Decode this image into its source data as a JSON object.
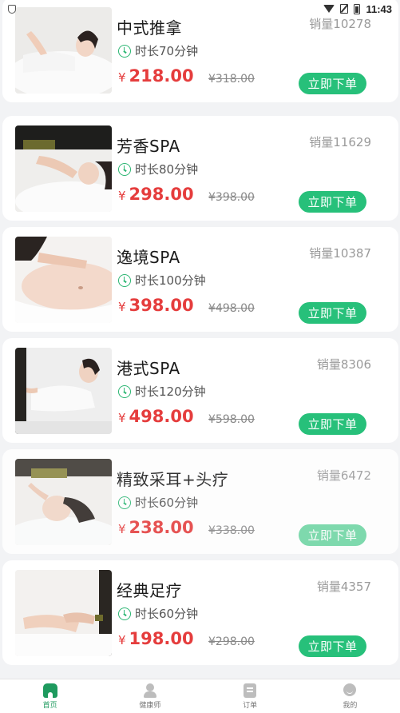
{
  "status_bar": {
    "time": "11:43"
  },
  "services": [
    {
      "name": "中式推拿",
      "sales": "销量10278",
      "duration": "时长70分钟",
      "currency": "¥",
      "price": "218.00",
      "original_price": "¥318.00",
      "order_label": "立即下单",
      "image": "massage-back-photo"
    },
    {
      "name": "芳香SPA",
      "sales": "销量11629",
      "duration": "时长80分钟",
      "currency": "¥",
      "price": "298.00",
      "original_price": "¥398.00",
      "order_label": "立即下单",
      "image": "neck-massage-photo"
    },
    {
      "name": "逸境SPA",
      "sales": "销量10387",
      "duration": "时长100分钟",
      "currency": "¥",
      "price": "398.00",
      "original_price": "¥498.00",
      "order_label": "立即下单",
      "image": "abdomen-massage-photo"
    },
    {
      "name": "港式SPA",
      "sales": "销量8306",
      "duration": "时长120分钟",
      "currency": "¥",
      "price": "498.00",
      "original_price": "¥598.00",
      "order_label": "立即下单",
      "image": "back-stretch-photo"
    },
    {
      "name": "精致采耳+头疗",
      "sales": "销量6472",
      "duration": "时长60分钟",
      "currency": "¥",
      "price": "238.00",
      "original_price": "¥338.00",
      "order_label": "立即下单",
      "image": "ear-care-photo"
    },
    {
      "name": "经典足疗",
      "sales": "销量4357",
      "duration": "时长60分钟",
      "currency": "¥",
      "price": "198.00",
      "original_price": "¥298.00",
      "order_label": "立即下单",
      "image": "foot-massage-photo"
    }
  ],
  "bottom_nav": [
    {
      "label": "首页",
      "icon": "home-icon",
      "active": true
    },
    {
      "label": "健康师",
      "icon": "therapist-icon",
      "active": false
    },
    {
      "label": "订单",
      "icon": "orders-icon",
      "active": false
    },
    {
      "label": "我的",
      "icon": "profile-icon",
      "active": false
    }
  ],
  "colors": {
    "accent": "#27c07a",
    "price": "#e53d3d",
    "nav_active": "#1e9a5e"
  }
}
